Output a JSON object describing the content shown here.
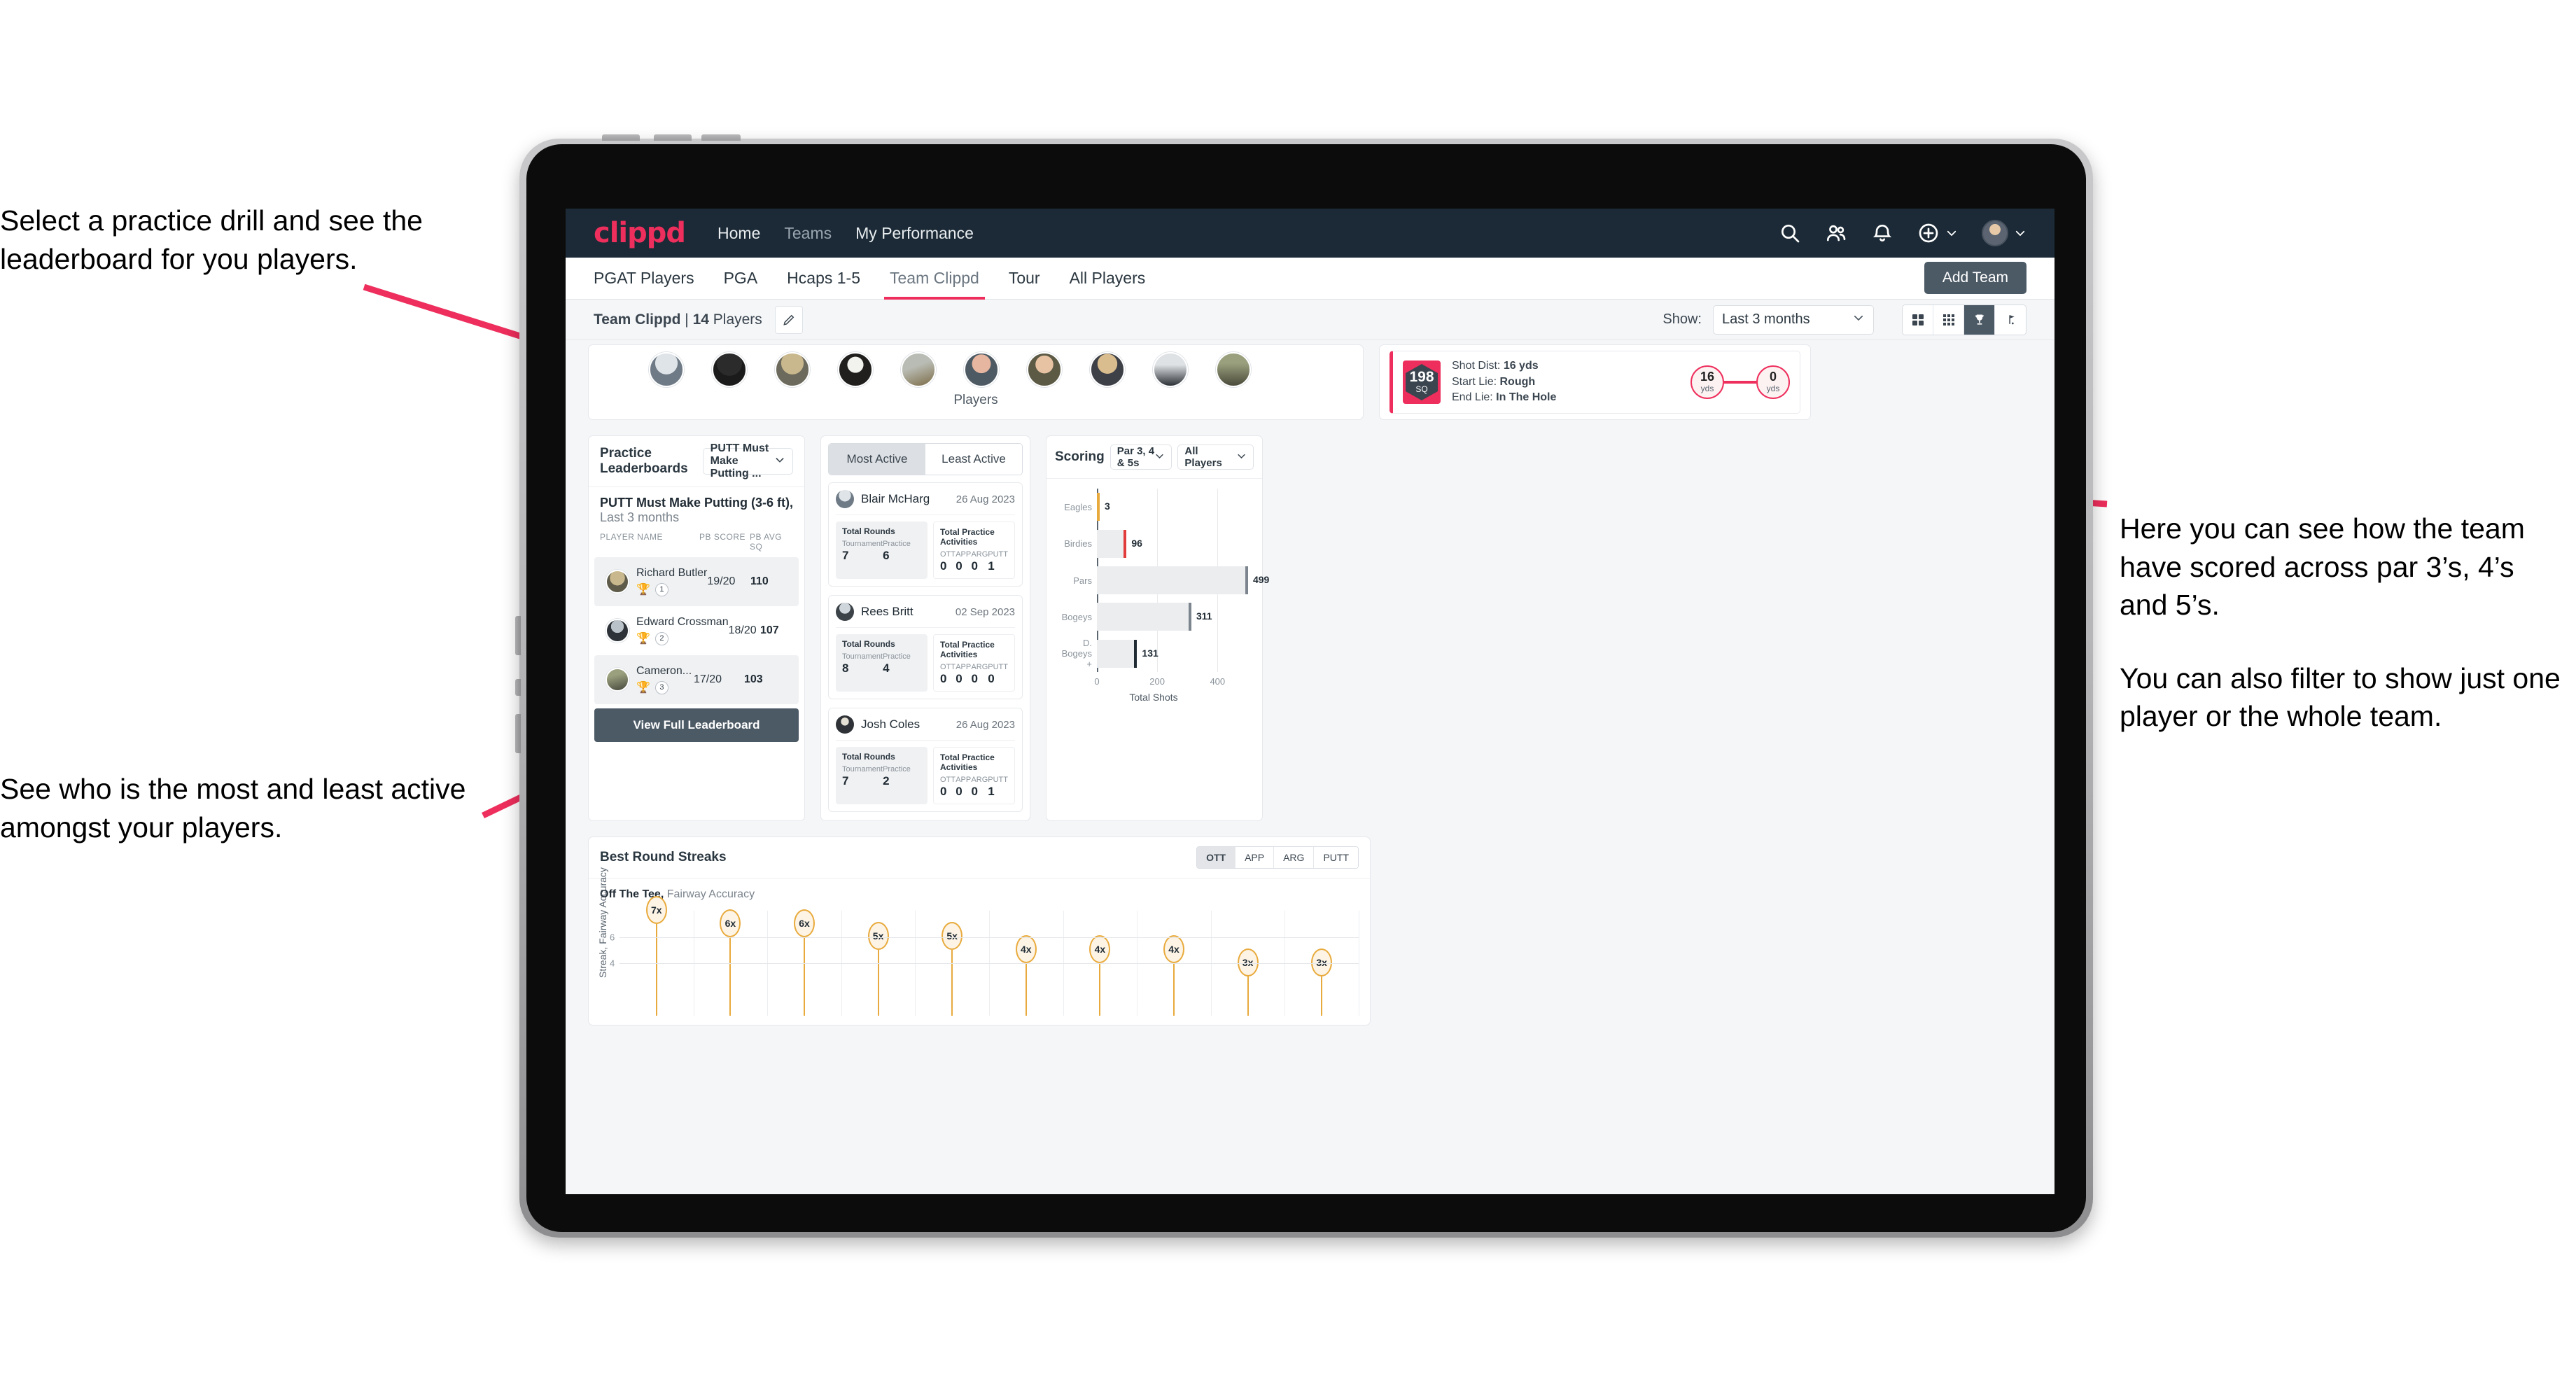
{
  "annotations": {
    "top_left": "Select a practice drill and see the leaderboard for you players.",
    "bottom_left": "See who is the most and least active amongst your players.",
    "right_1": "Here you can see how the team have scored across par 3’s, 4’s and 5’s.",
    "right_2": "You can also filter to show just one player or the whole team."
  },
  "colors": {
    "brand_pink": "#ee2e5c",
    "navbar_dark": "#1b2a36",
    "button_slate": "#4c5a66",
    "gold": "#e8aa3c"
  },
  "topnav": {
    "logo": "clippd",
    "links": [
      {
        "label": "Home",
        "dim": false
      },
      {
        "label": "Teams",
        "dim": true
      },
      {
        "label": "My Performance",
        "dim": false
      }
    ],
    "icons": [
      "search-icon",
      "people-icon",
      "bell-icon",
      "plus-circle-icon",
      "avatar"
    ]
  },
  "tabs": [
    {
      "label": "PGAT Players",
      "active": false
    },
    {
      "label": "PGA",
      "active": false
    },
    {
      "label": "Hcaps 1-5",
      "active": false
    },
    {
      "label": "Team Clippd",
      "active": true
    },
    {
      "label": "Tour",
      "active": false
    },
    {
      "label": "All Players",
      "active": false
    }
  ],
  "add_team_label": "Add Team",
  "subheader": {
    "team_name": "Team Clippd",
    "separator": " | ",
    "player_count": "14",
    "players_word": " Players",
    "edit_icon": "pencil-icon",
    "show_label": "Show:",
    "show_value": "Last 3 months",
    "view_toggle": [
      {
        "icon": "grid-2x2-icon",
        "active": false
      },
      {
        "icon": "grid-3x3-icon",
        "active": false
      },
      {
        "icon": "trophy-icon",
        "active": true
      },
      {
        "icon": "golf-flag-icon",
        "active": false
      }
    ]
  },
  "players_strip": {
    "label": "Players",
    "avatar_count": 10
  },
  "shot_card": {
    "sq_value": "198",
    "sq_unit": "SQ",
    "lines": [
      {
        "label": "Shot Dist:",
        "value": "16 yds"
      },
      {
        "label": "Start Lie:",
        "value": "Rough"
      },
      {
        "label": "End Lie:",
        "value": "In The Hole"
      }
    ],
    "start_dot": {
      "value": "16",
      "unit": "yds"
    },
    "end_dot": {
      "value": "0",
      "unit": "yds"
    }
  },
  "leaderboard": {
    "title": "Practice Leaderboards",
    "drill_select": "PUTT Must Make Putting ...",
    "subtitle_bold": "PUTT Must Make Putting (3-6 ft),",
    "subtitle_rest": " Last 3 months",
    "columns": [
      "PLAYER NAME",
      "PB SCORE",
      "PB AVG SQ"
    ],
    "rows": [
      {
        "name": "Richard Butler",
        "rank": "1",
        "trophy": "gold",
        "pb_score": "19/20",
        "pb_avg_sq": "110"
      },
      {
        "name": "Edward Crossman",
        "rank": "2",
        "trophy": "silver",
        "pb_score": "18/20",
        "pb_avg_sq": "107"
      },
      {
        "name": "Cameron...",
        "rank": "3",
        "trophy": "bronze",
        "pb_score": "17/20",
        "pb_avg_sq": "103"
      }
    ],
    "view_full_label": "View Full Leaderboard"
  },
  "activity": {
    "tabs": [
      {
        "label": "Most Active",
        "active": true
      },
      {
        "label": "Least Active",
        "active": false
      }
    ],
    "rounds_title": "Total Rounds",
    "activities_title": "Total Practice Activities",
    "rounds_keys": [
      "Tournament",
      "Practice"
    ],
    "activity_keys": [
      "OTT",
      "APP",
      "ARG",
      "PUTT"
    ],
    "players": [
      {
        "name": "Blair McHarg",
        "date": "26 Aug 2023",
        "rounds": [
          "7",
          "6"
        ],
        "activities": [
          "0",
          "0",
          "0",
          "1"
        ]
      },
      {
        "name": "Rees Britt",
        "date": "02 Sep 2023",
        "rounds": [
          "8",
          "4"
        ],
        "activities": [
          "0",
          "0",
          "0",
          "0"
        ]
      },
      {
        "name": "Josh Coles",
        "date": "26 Aug 2023",
        "rounds": [
          "7",
          "2"
        ],
        "activities": [
          "0",
          "0",
          "0",
          "1"
        ]
      }
    ]
  },
  "scoring": {
    "title": "Scoring",
    "par_filter": "Par 3, 4 & 5s",
    "player_filter": "All Players"
  },
  "streaks": {
    "title": "Best Round Streaks",
    "toggle": [
      {
        "label": "OTT",
        "active": true
      },
      {
        "label": "APP",
        "active": false
      },
      {
        "label": "ARG",
        "active": false
      },
      {
        "label": "PUTT",
        "active": false
      }
    ],
    "subtitle_bold": "Off The Tee,",
    "subtitle_rest": " Fairway Accuracy"
  },
  "chart_data": [
    {
      "type": "bar",
      "title": "Scoring",
      "orientation": "horizontal",
      "categories": [
        "Eagles",
        "Birdies",
        "Pars",
        "Bogeys",
        "D. Bogeys +"
      ],
      "values": [
        3,
        96,
        499,
        311,
        131
      ],
      "cap_colors": [
        "#e8aa3c",
        "#e23b3b",
        "#7c858d",
        "#7c858d",
        "#1f2a33"
      ],
      "xlabel": "Total Shots",
      "ylabel": "",
      "xlim": [
        0,
        520
      ],
      "xticks": [
        0,
        200,
        400
      ],
      "grid": true,
      "legend": "none"
    },
    {
      "type": "bar",
      "title": "Best Round Streaks",
      "subtitle": "Off The Tee, Fairway Accuracy",
      "style": "lollipop",
      "categories": [
        "",
        "",
        "",
        "",
        "",
        "",
        "",
        "",
        "",
        ""
      ],
      "values": [
        7,
        6,
        6,
        5,
        5,
        4,
        4,
        4,
        3,
        3
      ],
      "labels": [
        "7x",
        "6x",
        "6x",
        "5x",
        "5x",
        "4x",
        "4x",
        "4x",
        "3x",
        "3x"
      ],
      "ylabel": "Streak, Fairway Accuracy",
      "ylim": [
        0,
        8
      ],
      "yticks": [
        4,
        6
      ],
      "grid": true,
      "series_color": "#e8aa3c"
    }
  ]
}
